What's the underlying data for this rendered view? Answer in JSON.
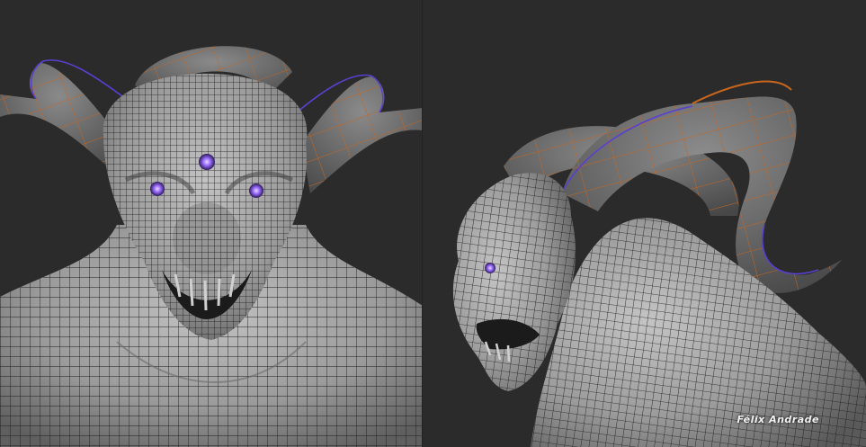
{
  "signature": "Félix Andrade",
  "colors": {
    "background": "#2b2b2b",
    "mesh_skin": "#a9a9a9",
    "wireframe": "#1c1c1c",
    "horn_edge_orange": "#c8661e",
    "horn_edge_purple": "#5a3fd0",
    "eye_glow": "#9a6cff"
  },
  "views": [
    "front-view",
    "side-view"
  ]
}
